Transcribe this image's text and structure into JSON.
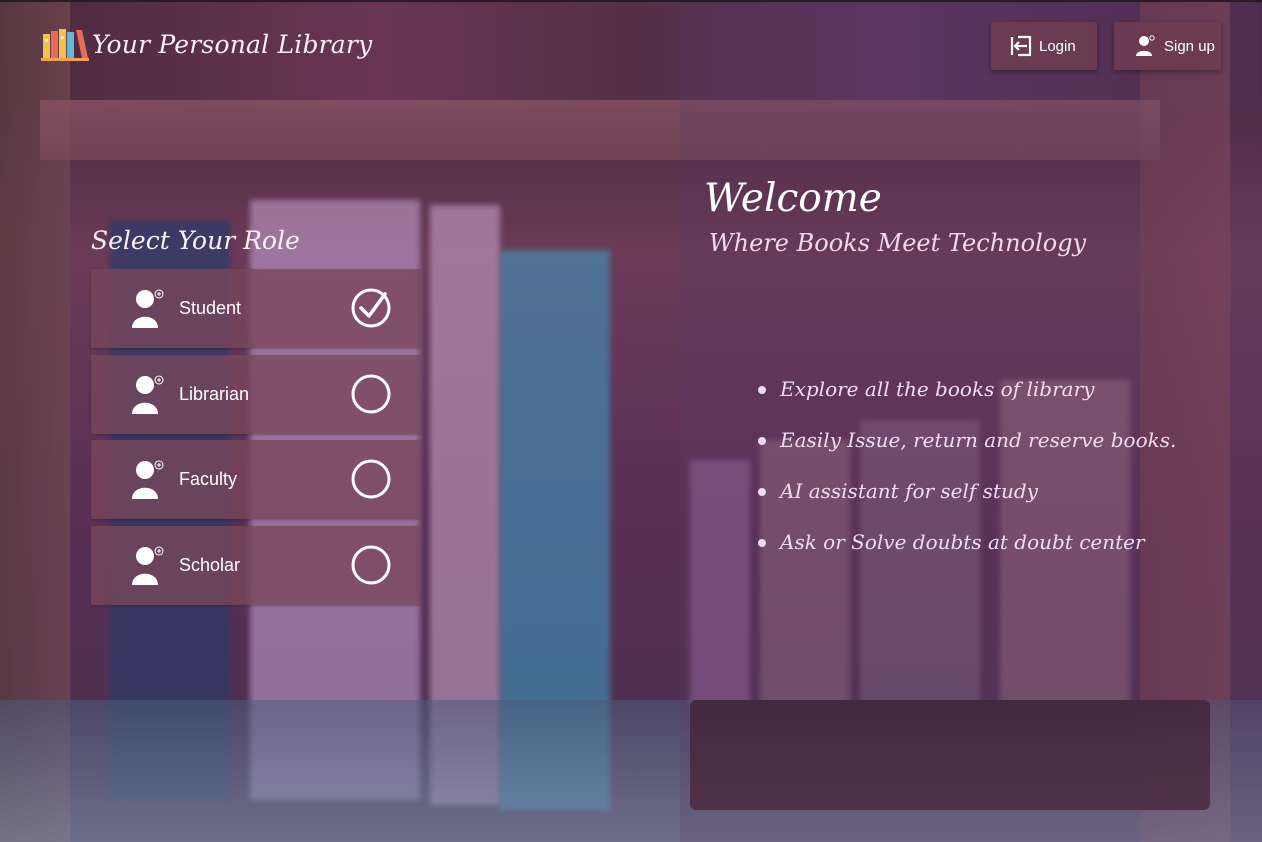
{
  "header": {
    "brand_title": "Your Personal Library",
    "login_label": "Login",
    "signup_label": "Sign up"
  },
  "roles": {
    "heading": "Select Your Role",
    "items": [
      {
        "label": "Student",
        "selected": true
      },
      {
        "label": "Librarian",
        "selected": false
      },
      {
        "label": "Faculty",
        "selected": false
      },
      {
        "label": "Scholar",
        "selected": false
      }
    ]
  },
  "welcome": {
    "title": "Welcome",
    "tagline": "Where Books Meet Technology",
    "features": [
      "Explore all the books of library",
      "Easily Issue, return and reserve books.",
      "AI assistant for self study",
      "Ask or Solve doubts at doubt center"
    ]
  },
  "icons": {
    "logo": "books-logo-icon",
    "login": "login-icon",
    "signup": "add-user-icon",
    "role": "user-add-icon",
    "selected": "check-circle-icon",
    "unselected": "radio-empty-icon"
  },
  "colors": {
    "card_bg": "#784658",
    "button_bg": "#6e3c50",
    "text": "#ffffff"
  }
}
